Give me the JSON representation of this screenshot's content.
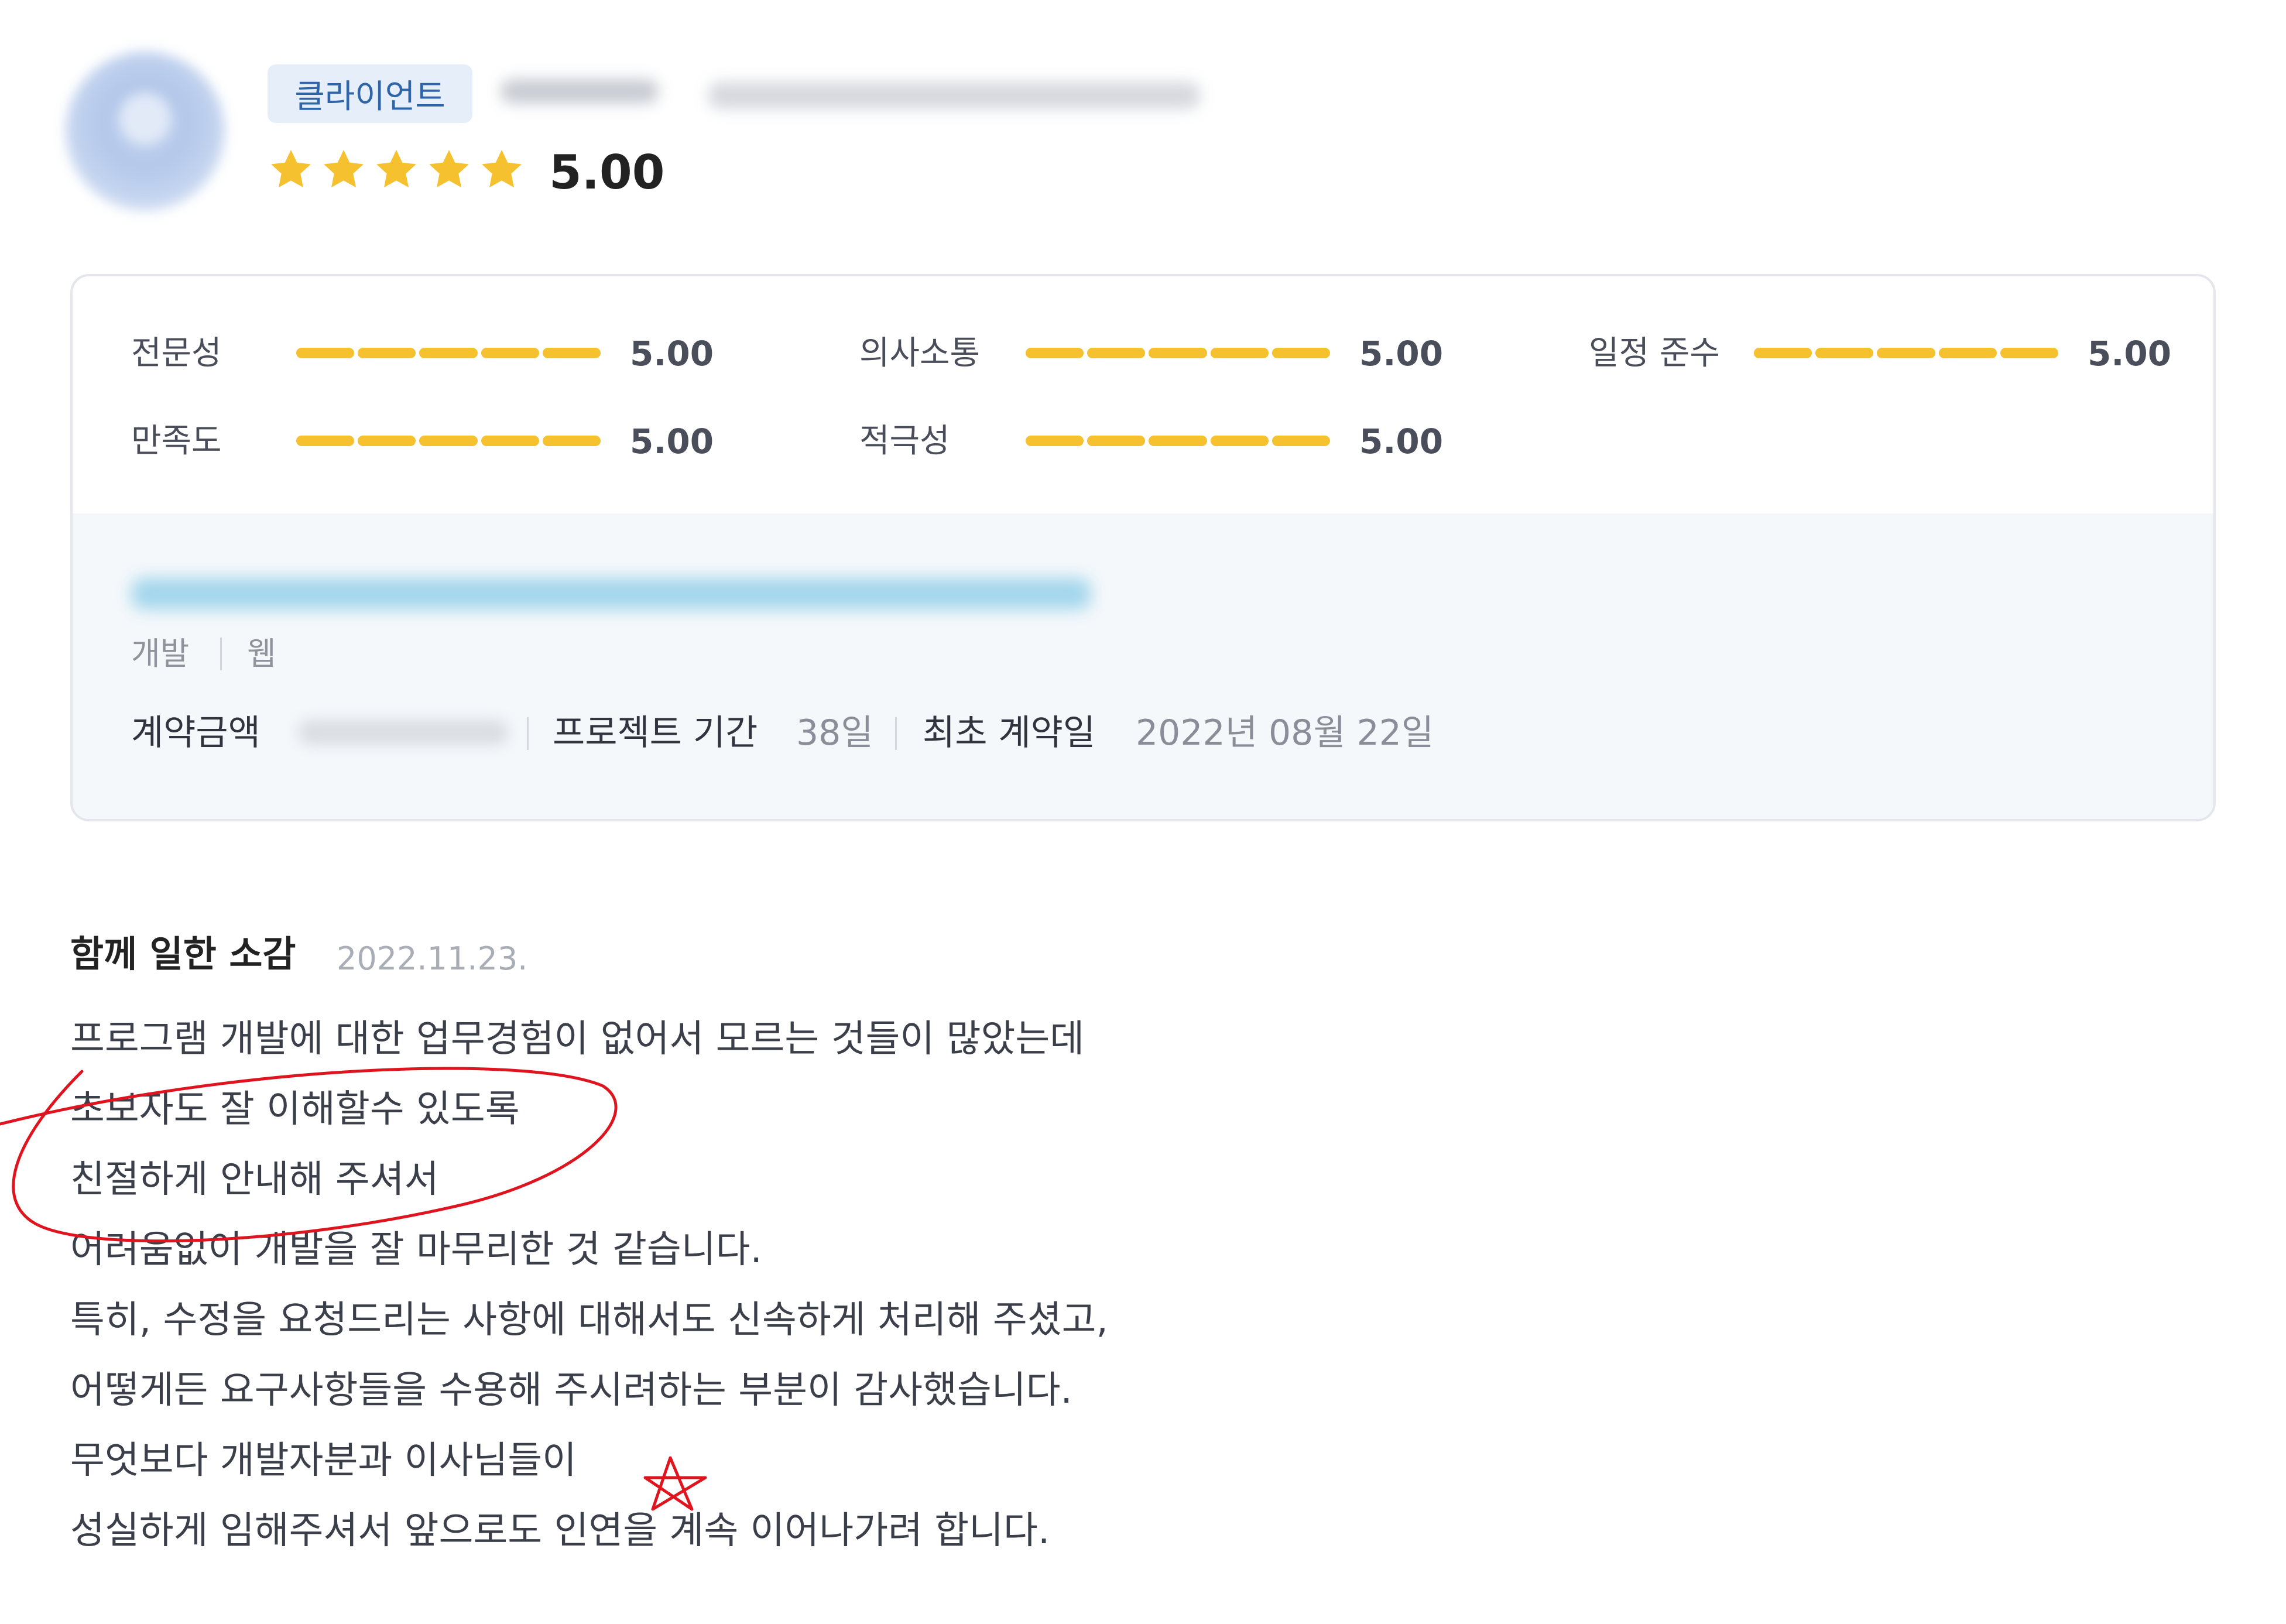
{
  "header": {
    "badge": "클라이언트",
    "rating": "5.00",
    "star_count": 5,
    "star_color": "#f6c12f"
  },
  "metrics": [
    {
      "label": "전문성",
      "value": "5.00"
    },
    {
      "label": "의사소통",
      "value": "5.00"
    },
    {
      "label": "일정 준수",
      "value": "5.00"
    },
    {
      "label": "만족도",
      "value": "5.00"
    },
    {
      "label": "적극성",
      "value": "5.00"
    }
  ],
  "project": {
    "category": "개발",
    "subcategory": "웹",
    "contract_amount_label": "계약금액",
    "duration_label": "프로젝트 기간",
    "duration_value": "38일",
    "first_contract_label": "최초 계약일",
    "first_contract_value": "2022년 08월 22일"
  },
  "review": {
    "title": "함께 일한 소감",
    "date": "2022.11.23.",
    "lines": [
      "프로그램 개발에 대한 업무경험이 없어서 모르는 것들이 많았는데",
      "초보자도 잘 이해할수 있도록",
      "친절하게 안내해 주셔서",
      "어려움없이 개발을 잘 마무리한 것 같습니다.",
      "특히, 수정을 요청드리는 사항에 대해서도 신속하게 처리해 주셨고,",
      "어떻게든 요구사항들을 수용해 주시려하는 부분이 감사했습니다.",
      "무엇보다 개발자분과 이사님들이",
      "성실하게 임해주셔서 앞으로도 인연을 계속 이어나가려 합니다."
    ]
  },
  "colors": {
    "accent": "#f6c12f",
    "badge_bg": "#e5eef9",
    "badge_text": "#2e64a8",
    "annotation": "#e0141e"
  }
}
